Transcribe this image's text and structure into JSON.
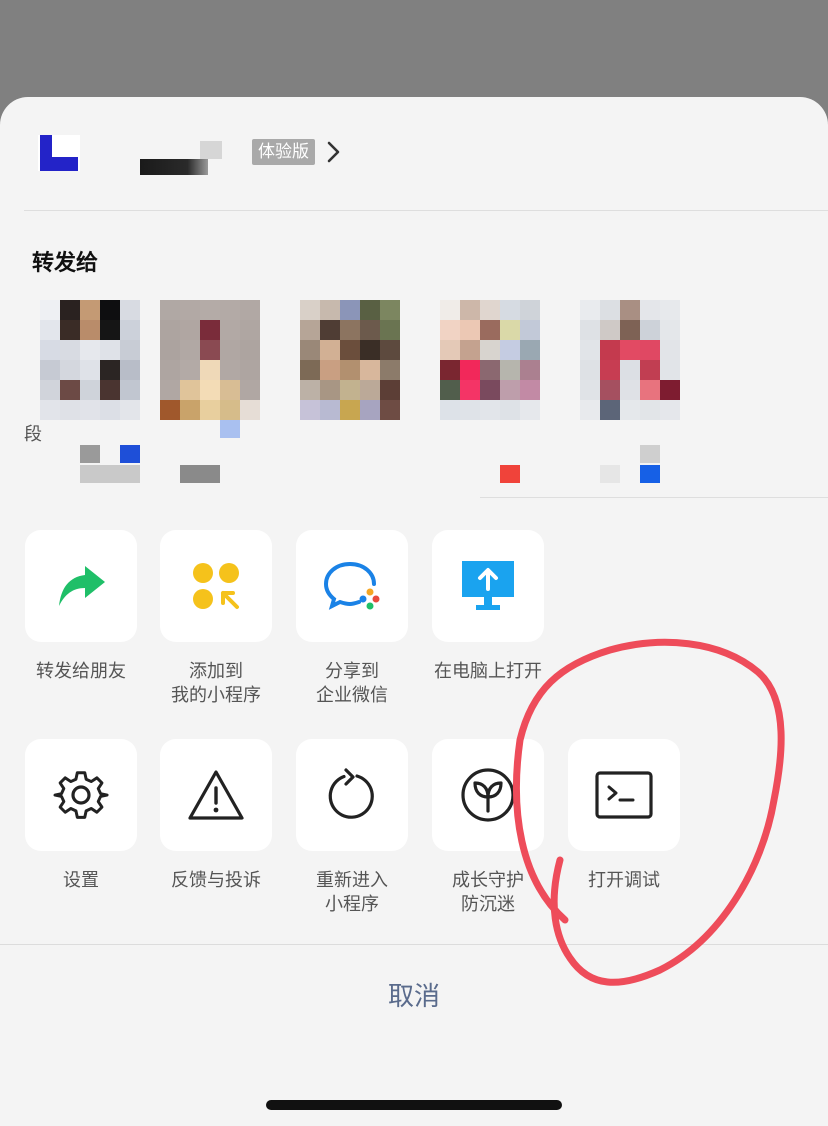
{
  "header": {
    "trial_badge": "体验版"
  },
  "share": {
    "title": "转发给",
    "first_contact_partial": "段"
  },
  "actions_row1": [
    {
      "label": "转发给朋友",
      "icon": "share-arrow-icon"
    },
    {
      "label": "添加到\n我的小程序",
      "icon": "add-miniprogram-icon"
    },
    {
      "label": "分享到\n企业微信",
      "icon": "wecom-icon"
    },
    {
      "label": "在电脑上打开",
      "icon": "open-on-pc-icon"
    }
  ],
  "actions_row2": [
    {
      "label": "设置",
      "icon": "gear-icon"
    },
    {
      "label": "反馈与投诉",
      "icon": "warning-icon"
    },
    {
      "label": "重新进入\n小程序",
      "icon": "reload-icon"
    },
    {
      "label": "成长守护\n防沉迷",
      "icon": "sprout-icon"
    },
    {
      "label": "打开调试",
      "icon": "terminal-icon"
    }
  ],
  "cancel_label": "取消",
  "colors": {
    "share_green": "#1fbf68",
    "add_yellow": "#f5c21b",
    "pc_blue": "#1aa3ef",
    "annotation_red": "#ee4c5a"
  }
}
